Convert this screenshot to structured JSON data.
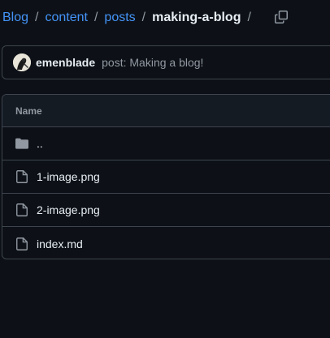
{
  "breadcrumb": {
    "items": [
      "Blog",
      "content",
      "posts"
    ],
    "separator": "/",
    "current": "making-a-blog",
    "trailing_separator": "/"
  },
  "commit": {
    "author": "emenblade",
    "message": "post: Making a blog!"
  },
  "file_table": {
    "header": "Name",
    "rows": [
      {
        "name": "..",
        "icon": "folder-icon"
      },
      {
        "name": "1-image.png",
        "icon": "file-icon"
      },
      {
        "name": "2-image.png",
        "icon": "file-icon"
      },
      {
        "name": "index.md",
        "icon": "file-icon"
      }
    ]
  },
  "colors": {
    "background": "#0d1117",
    "link": "#4493f8",
    "border": "#3d444d",
    "muted": "#9198a1",
    "text": "#e6edf3"
  }
}
